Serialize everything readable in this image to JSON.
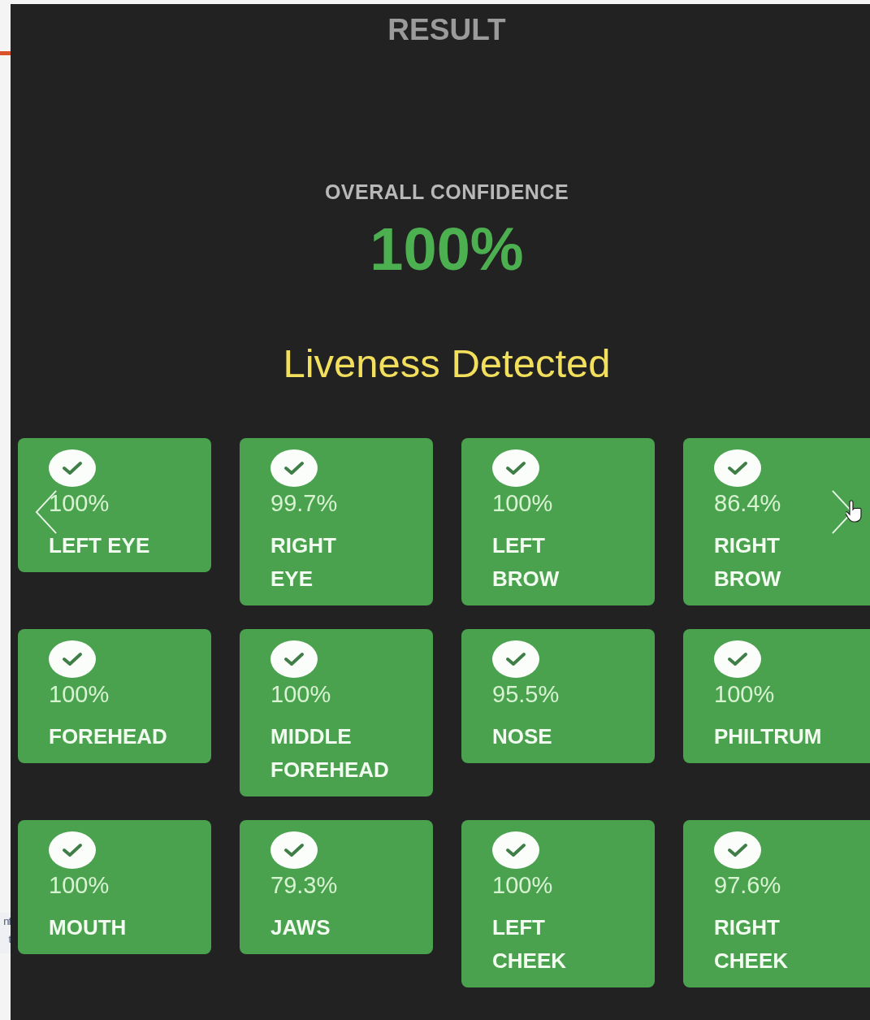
{
  "side_text": [
    "nf",
    "t"
  ],
  "result": {
    "title": "RESULT",
    "confidence_label": "OVERALL CONFIDENCE",
    "confidence_value": "100%",
    "status": "Liveness Detected"
  },
  "regions": [
    {
      "lines": [
        "LEFT EYE"
      ],
      "percent": "100%",
      "passed": true
    },
    {
      "lines": [
        "RIGHT",
        "EYE"
      ],
      "percent": "99.7%",
      "passed": true
    },
    {
      "lines": [
        "LEFT",
        "BROW"
      ],
      "percent": "100%",
      "passed": true
    },
    {
      "lines": [
        "RIGHT",
        "BROW"
      ],
      "percent": "86.4%",
      "passed": true
    },
    {
      "lines": [
        "FOREHEAD"
      ],
      "percent": "100%",
      "passed": true
    },
    {
      "lines": [
        "MIDDLE",
        "FOREHEAD"
      ],
      "percent": "100%",
      "passed": true
    },
    {
      "lines": [
        "NOSE"
      ],
      "percent": "95.5%",
      "passed": true
    },
    {
      "lines": [
        "PHILTRUM"
      ],
      "percent": "100%",
      "passed": true
    },
    {
      "lines": [
        "MOUTH"
      ],
      "percent": "100%",
      "passed": true
    },
    {
      "lines": [
        "JAWS"
      ],
      "percent": "79.3%",
      "passed": true
    },
    {
      "lines": [
        "LEFT",
        "CHEEK"
      ],
      "percent": "100%",
      "passed": true
    },
    {
      "lines": [
        "RIGHT",
        "CHEEK"
      ],
      "percent": "97.6%",
      "passed": true
    }
  ]
}
